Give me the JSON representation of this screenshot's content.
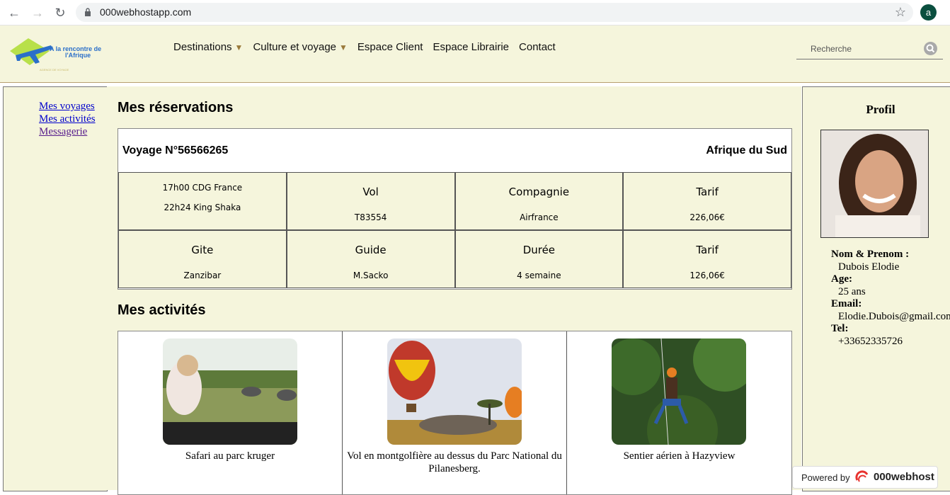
{
  "browser": {
    "url": "000webhostapp.com",
    "profile_initial": "a"
  },
  "header": {
    "logo_text_line1": "A la rencontre de",
    "logo_text_line2": "l'Afrique",
    "logo_tagline": "AGENCE DE VOYAGE",
    "menu": [
      {
        "label": "Destinations",
        "has_dropdown": true
      },
      {
        "label": "Culture et voyage",
        "has_dropdown": true
      },
      {
        "label": "Espace Client",
        "has_dropdown": false
      },
      {
        "label": "Espace Librairie",
        "has_dropdown": false
      },
      {
        "label": "Contact",
        "has_dropdown": false
      }
    ],
    "search_placeholder": "Recherche",
    "dropdown_arrow": "▼"
  },
  "sidebar": {
    "links": [
      "Mes voyages",
      "Mes activités",
      "Messagerie"
    ]
  },
  "reservations": {
    "title": "Mes réservations",
    "voyage_label": "Voyage N°56566265",
    "destination": "Afrique du Sud",
    "schedule": [
      "17h00 CDG France",
      "22h24 King Shaka"
    ],
    "row1": [
      {
        "header": "Vol",
        "value": "T83554"
      },
      {
        "header": "Compagnie",
        "value": "Airfrance"
      },
      {
        "header": "Tarif",
        "value": "226,06€"
      }
    ],
    "row2": [
      {
        "header": "Gite",
        "value": "Zanzibar"
      },
      {
        "header": "Guide",
        "value": "M.Sacko"
      },
      {
        "header": "Durée",
        "value": "4 semaine"
      },
      {
        "header": "Tarif",
        "value": "126,06€"
      }
    ]
  },
  "activities": {
    "title": "Mes activités",
    "items": [
      {
        "caption": "Safari au parc kruger"
      },
      {
        "caption": "Vol en montgolfière au dessus du Parc National du Pilanesberg."
      },
      {
        "caption": "Sentier aérien à Hazyview"
      }
    ]
  },
  "profile": {
    "title": "Profil",
    "name_label": "Nom & Prenom :",
    "name": "Dubois Elodie",
    "age_label": "Age:",
    "age": "25 ans",
    "email_label": "Email:",
    "email": "Elodie.Dubois@gmail.com",
    "tel_label": "Tel:",
    "tel": "+33652335726"
  },
  "badge": {
    "powered_by": "Powered by",
    "brand": "000webhost"
  },
  "colors": {
    "page_bg": "#f5f5dc",
    "link": "#0000cc",
    "visited": "#551a8b"
  }
}
